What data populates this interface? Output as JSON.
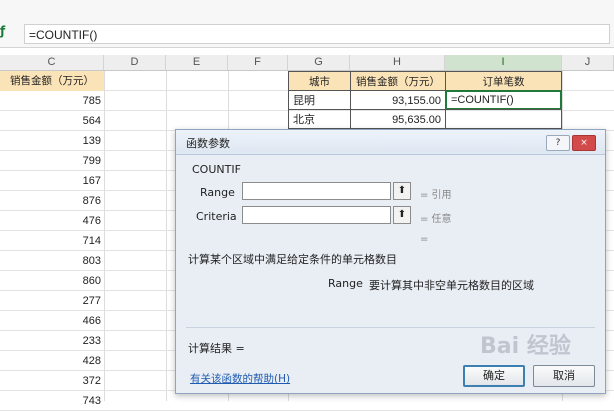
{
  "formula_bar": {
    "fx_icon": "function-icon",
    "value": "=COUNTIF()"
  },
  "columns": [
    "C",
    "D",
    "E",
    "F",
    "G",
    "H",
    "I",
    "J"
  ],
  "selected_column": "I",
  "col_c": {
    "header": "销售金额（万元）",
    "values": [
      "785",
      "564",
      "139",
      "799",
      "167",
      "876",
      "476",
      "714",
      "803",
      "860",
      "277",
      "466",
      "233",
      "428",
      "372",
      "743"
    ]
  },
  "table": {
    "headers": [
      "城市",
      "销售金额（万元）",
      "订单笔数"
    ],
    "rows": [
      [
        "昆明",
        "93,155.00",
        "=COUNTIF()"
      ],
      [
        "北京",
        "95,635.00",
        ""
      ]
    ]
  },
  "dialog": {
    "title": "函数参数",
    "title_buttons": {
      "help": "?",
      "close": "×"
    },
    "function_name": "COUNTIF",
    "args": [
      {
        "label": "Range",
        "value": "",
        "hint": "= 引用"
      },
      {
        "label": "Criteria",
        "value": "",
        "hint": "= 任意"
      }
    ],
    "result_eq": "=",
    "description": "计算某个区域中满足给定条件的单元格数目",
    "arg_help_name": "Range",
    "arg_help_text": "要计算其中非空单元格数目的区域",
    "calc_result_label": "计算结果 =",
    "help_link": "有关该函数的帮助(H)",
    "ok_label": "确定",
    "cancel_label": "取消",
    "pick_icon": "range-picker-icon"
  },
  "watermark": "Bai 经验"
}
